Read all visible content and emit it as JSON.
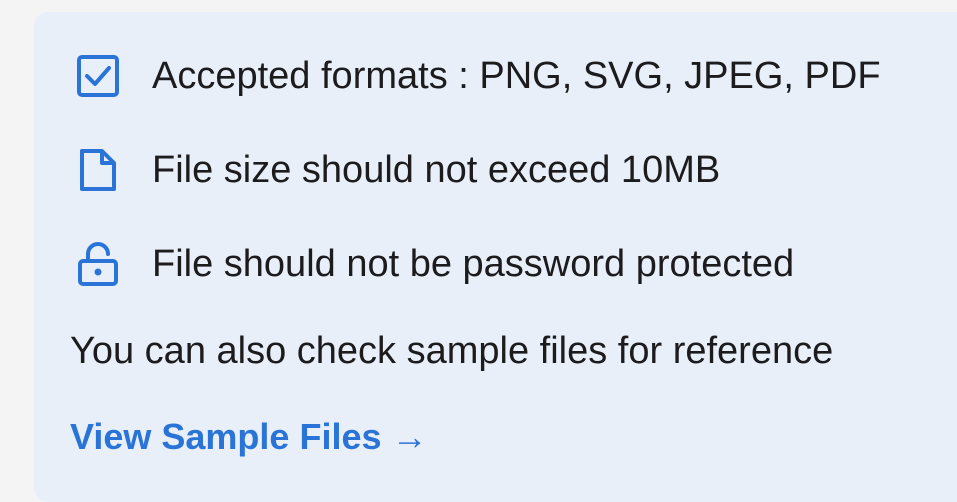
{
  "requirements": [
    {
      "icon": "checkbox-icon",
      "text": "Accepted formats : PNG, SVG, JPEG, PDF"
    },
    {
      "icon": "file-icon",
      "text": "File size should not exceed 10MB"
    },
    {
      "icon": "unlock-icon",
      "text": "File should not be password protected"
    }
  ],
  "note": "You can also check sample files for reference",
  "link": {
    "label": "View Sample Files →"
  },
  "colors": {
    "accent": "#2a74d8",
    "panel_bg": "#e8eff9",
    "text": "#1c1c1e"
  }
}
